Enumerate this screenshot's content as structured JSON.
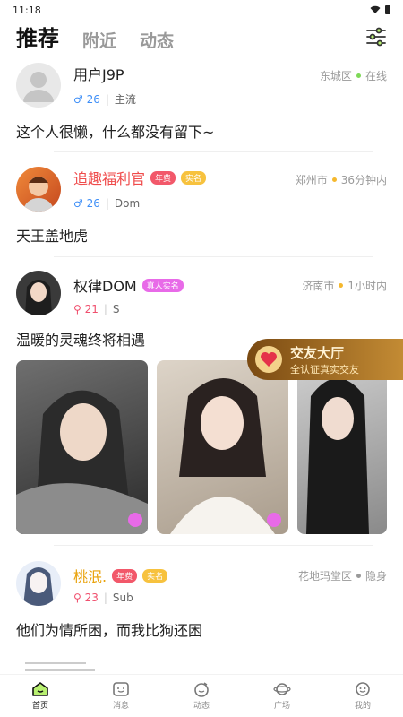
{
  "status": {
    "time": "11:18"
  },
  "tabs": [
    {
      "label": "推荐"
    },
    {
      "label": "附近"
    },
    {
      "label": "动态"
    }
  ],
  "posts": [
    {
      "name": "用户J9P",
      "gender_age": "♂ 26",
      "tag": "主流",
      "location": "东城区",
      "status": "在线",
      "status_color": "#7ed957",
      "content": "这个人很懒，什么都没有留下~"
    },
    {
      "name": "追趣福利官",
      "badge_vip": "年费",
      "badge_real": "实名",
      "gender_age": "♂ 26",
      "tag": "Dom",
      "location": "郑州市",
      "status": "36分钟内",
      "status_color": "#f5b82e",
      "content": "天王盖地虎"
    },
    {
      "name": "权律DOM",
      "badge_real": "真人实名",
      "gender_age": "⚲ 21",
      "tag": "S",
      "location": "济南市",
      "status": "1小时内",
      "status_color": "#f5b82e",
      "content": "温暖的灵魂终将相遇"
    },
    {
      "name": "桃泯.",
      "badge_vip": "年费",
      "badge_real": "实名",
      "gender_age": "⚲ 23",
      "tag": "Sub",
      "location": "花地玛堂区",
      "status": "隐身",
      "status_color": "#999999",
      "content": "他们为情所困，而我比狗还困"
    }
  ],
  "promo": {
    "title": "交友大厅",
    "subtitle": "全认证真实交友"
  },
  "bottom_nav": [
    {
      "label": "首页"
    },
    {
      "label": "消息"
    },
    {
      "label": "动态"
    },
    {
      "label": "广场"
    },
    {
      "label": "我的"
    }
  ]
}
